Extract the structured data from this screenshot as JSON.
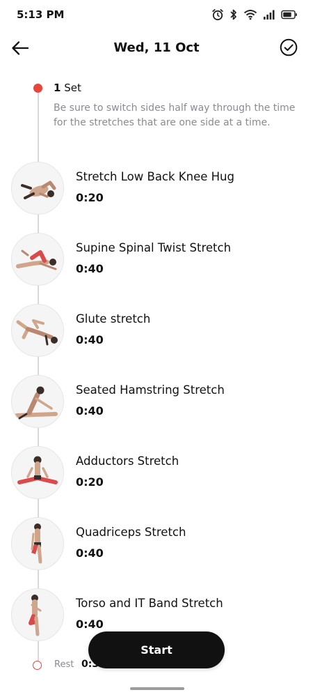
{
  "status_bar": {
    "time": "5:13 PM",
    "icons": [
      "alarm-icon",
      "bluetooth-icon",
      "wifi-icon",
      "signal-icon",
      "battery-icon"
    ]
  },
  "header": {
    "title": "Wed, 11 Oct",
    "back_icon": "back-arrow-icon",
    "done_icon": "check-circle-icon"
  },
  "set": {
    "count": "1",
    "label": "Set",
    "note": "Be sure to switch sides half way through the time for the stretches that are one side at a time."
  },
  "exercises": [
    {
      "name": "Stretch Low Back Knee Hug",
      "duration": "0:20",
      "icon": "knee-hug-figure"
    },
    {
      "name": "Supine Spinal Twist Stretch",
      "duration": "0:40",
      "icon": "spinal-twist-figure"
    },
    {
      "name": "Glute stretch",
      "duration": "0:40",
      "icon": "glute-stretch-figure"
    },
    {
      "name": "Seated Hamstring Stretch",
      "duration": "0:40",
      "icon": "hamstring-stretch-figure"
    },
    {
      "name": "Adductors Stretch",
      "duration": "0:20",
      "icon": "adductors-stretch-figure"
    },
    {
      "name": "Quadriceps Stretch",
      "duration": "0:40",
      "icon": "quadriceps-stretch-figure"
    },
    {
      "name": "Torso and IT Band Stretch",
      "duration": "0:40",
      "icon": "it-band-stretch-figure"
    }
  ],
  "rest": {
    "label": "Rest",
    "duration": "0:30"
  },
  "actions": {
    "start_label": "Start"
  },
  "colors": {
    "accent": "#e8453c",
    "button": "#111111",
    "muted_text": "#8a8a94",
    "timeline": "#d8d8dc"
  }
}
